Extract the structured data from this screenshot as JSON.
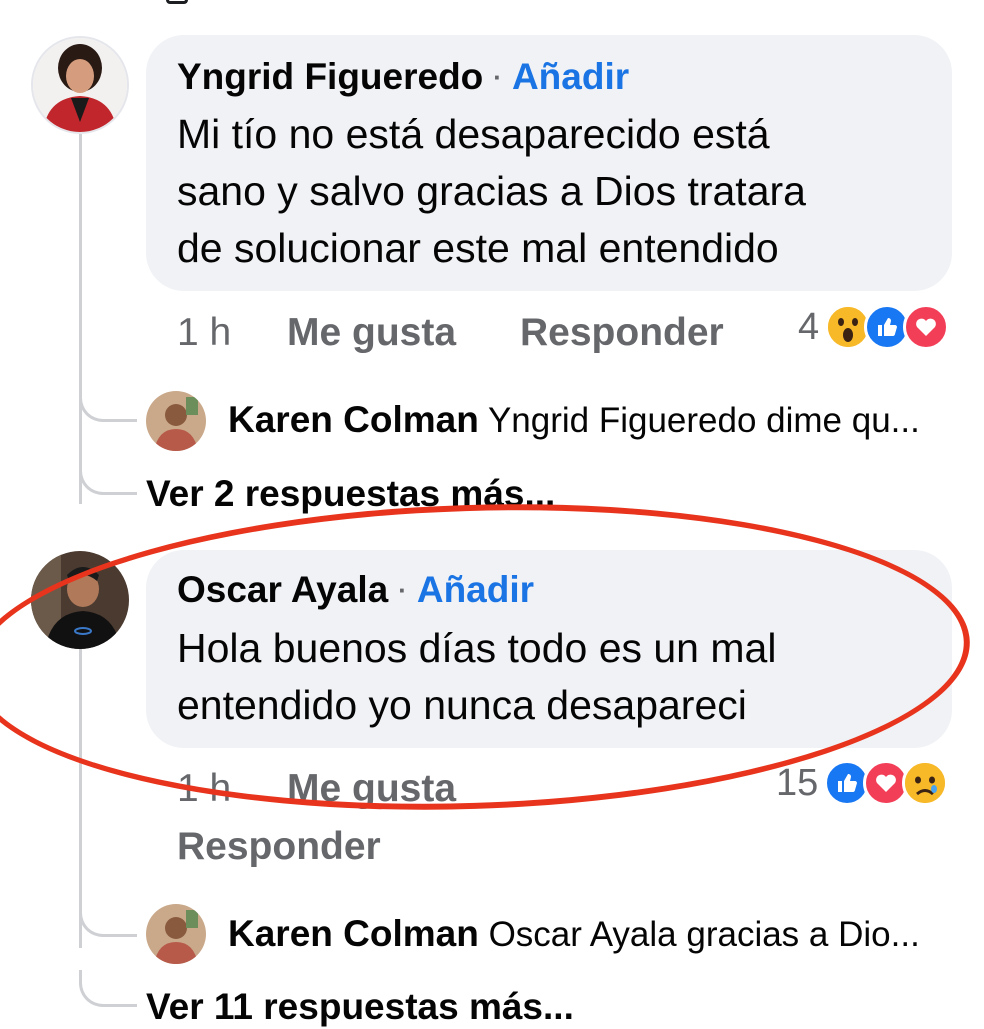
{
  "comments": [
    {
      "author": "Yngrid Figueredo",
      "separator": "·",
      "add_label": "Añadir",
      "lines": [
        "Mi tío no está desaparecido está",
        "sano y salvo gracias a Dios tratara",
        "de solucionar este mal entendido"
      ],
      "time": "1 h",
      "like_label": "Me gusta",
      "reply_label": "Responder",
      "reaction_count": "4",
      "reactions": [
        "wow",
        "like",
        "love"
      ],
      "reply_preview": {
        "author": "Karen Colman",
        "text": "Yngrid Figueredo dime qu..."
      },
      "more_replies": "Ver 2 respuestas más..."
    },
    {
      "author": "Oscar Ayala",
      "separator": "·",
      "add_label": "Añadir",
      "lines": [
        "Hola buenos días todo es un mal",
        "entendido yo nunca desapareci"
      ],
      "time": "1 h",
      "like_label": "Me gusta",
      "reply_label": "Responder",
      "reaction_count": "15",
      "reactions": [
        "like",
        "love",
        "sad"
      ],
      "reply_preview": {
        "author": "Karen Colman",
        "text": "Oscar Ayala gracias a Dio..."
      },
      "more_replies": "Ver 11 respuestas más..."
    }
  ],
  "colors": {
    "accent": "#1b74e4",
    "bubble": "#f0f2f5",
    "annotation": "#e8341c",
    "muted": "#65676b"
  }
}
